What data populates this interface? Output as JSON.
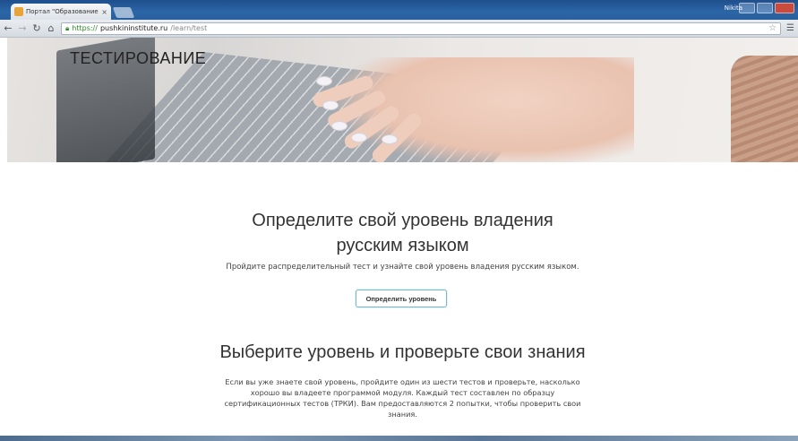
{
  "browser": {
    "tab_title": "Портал \"Образование н",
    "tab_close": "×",
    "user_name": "Nikita",
    "url_scheme": "https://",
    "url_host": "pushkininstitute.ru",
    "url_path": "/learn/test",
    "icons": [
      "back-icon",
      "forward-icon",
      "reload-icon",
      "home-icon",
      "lock-icon",
      "star-icon",
      "menu-icon"
    ]
  },
  "hero": {
    "title": "ТЕСТИРОВАНИЕ"
  },
  "level_section": {
    "heading_line1": "Определите свой уровень владения",
    "heading_line2": "русским языком",
    "description": "Пройдите распределительный тест и узнайте свой уровень владения русским языком.",
    "button_label": "Определить уровень"
  },
  "knowledge_section": {
    "heading": "Выберите уровень и проверьте свои знания",
    "text": "Если вы уже знаете свой уровень, пройдите один из шести тестов и проверьте, насколько хорошо вы владеете программой модуля. Каждый тест составлен по образцу сертификационных тестов (ТРКИ). Вам предоставляются 2 попытки, чтобы проверить свои знания."
  },
  "colors": {
    "button_border": "#78b9c9",
    "titlebar": "#2b66a8",
    "secure_green": "#2a8a2a"
  }
}
